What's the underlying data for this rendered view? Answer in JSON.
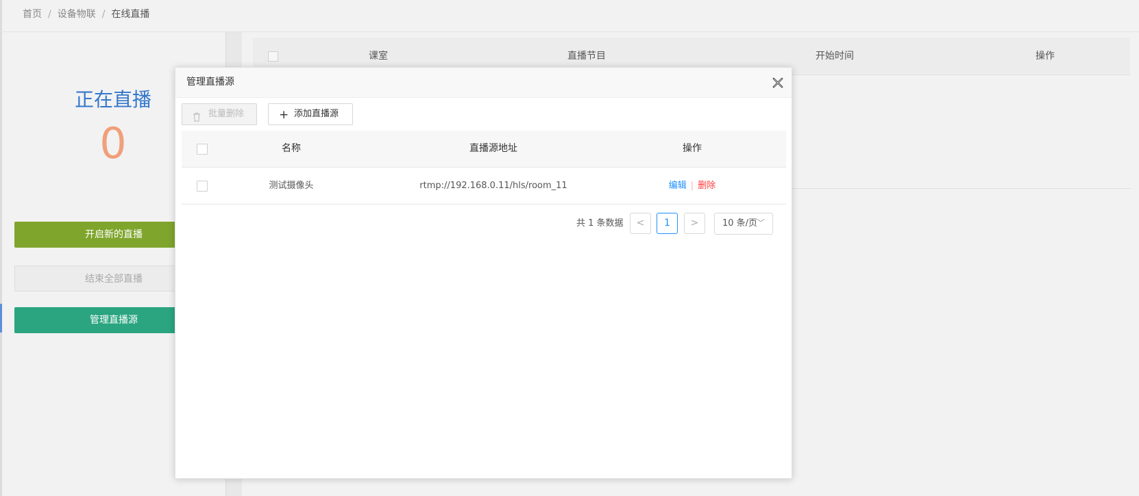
{
  "breadcrumb": {
    "home": "首页",
    "module": "设备物联",
    "current": "在线直播",
    "sep": "/"
  },
  "left_panel": {
    "live_title": "正在直播",
    "live_count": "0",
    "start_button": "开启新的直播",
    "stop_all_button": "结束全部直播",
    "manage_sources_button": "管理直播源"
  },
  "background_table": {
    "columns": {
      "classroom": "课室",
      "program": "直播节目",
      "start_time": "开始时间",
      "action": "操作"
    }
  },
  "modal": {
    "title": "管理直播源",
    "toolbar": {
      "batch_delete": "批量删除",
      "add_source": "添加直播源"
    },
    "table": {
      "columns": {
        "name": "名称",
        "url": "直播源地址",
        "action": "操作"
      },
      "rows": [
        {
          "name": "测试摄像头",
          "url": "rtmp://192.168.0.11/hls/room_11",
          "edit": "编辑",
          "delete": "删除"
        }
      ]
    },
    "pagination": {
      "total_text": "共 1 条数据",
      "current_page": "1",
      "page_size": "10 条/页"
    }
  },
  "colors": {
    "live_title": "#3377cc",
    "live_count": "#f0a07a",
    "start_button": "#7fa52c",
    "manage_button": "#2aa57f",
    "link_blue": "#1e90ff",
    "delete_red": "#ff3b3b"
  },
  "icons": {
    "close": "close-icon",
    "trash": "trash-icon",
    "plus": "plus-icon",
    "prev": "chevron-left-icon",
    "next": "chevron-right-icon",
    "dropdown": "chevron-down-icon"
  }
}
